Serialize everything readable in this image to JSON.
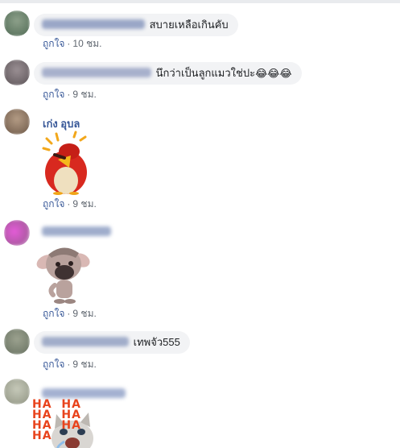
{
  "comments": [
    {
      "text": "สบายเหลือเกินคับ",
      "like_label": "ถูกใจ",
      "time": "10 ชม."
    },
    {
      "text": "นึกว่าเป็นลูกแมวใช่ปะ",
      "emojis": "😂😂😂",
      "like_label": "ถูกใจ",
      "time": "9 ชม."
    },
    {
      "author": "เก่ง อุบล",
      "like_label": "ถูกใจ",
      "time": "9 ชม."
    },
    {
      "like_label": "ถูกใจ",
      "time": "9 ชม."
    },
    {
      "text": "เทพจัว555",
      "like_label": "ถูกใจ",
      "time": "9 ชม."
    },
    {
      "sticker_text": "HA HA HA HA HA HA HA"
    }
  ],
  "separator": "·",
  "colors": {
    "link": "#385898",
    "meta": "#606770",
    "bubble": "#f2f3f5"
  }
}
